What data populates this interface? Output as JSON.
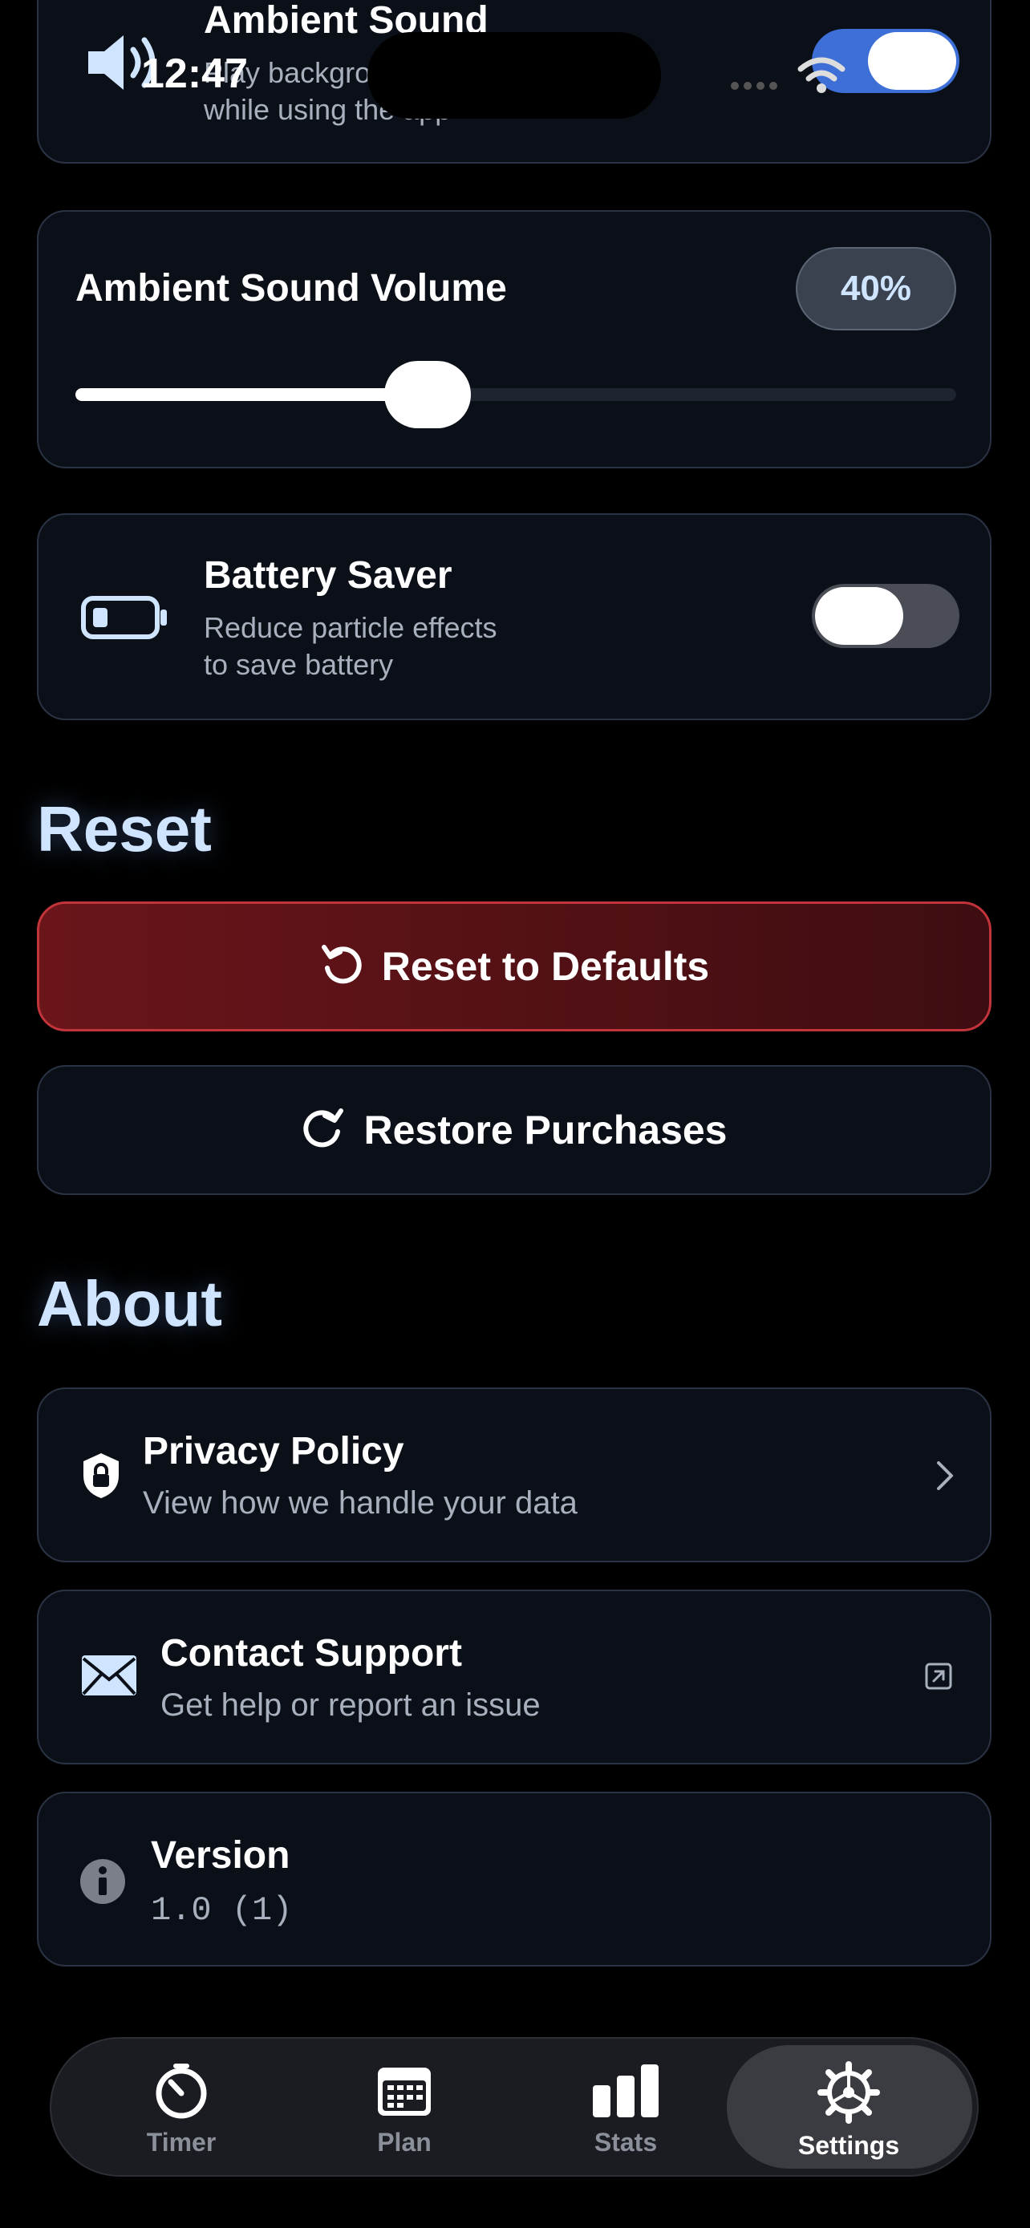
{
  "status_bar": {
    "time": "12:47"
  },
  "ambient_sound": {
    "title": "Ambient Sound",
    "subtitle_line1": "Play background sounds",
    "subtitle_line2": "while using the app",
    "enabled": true
  },
  "ambient_volume": {
    "title": "Ambient Sound Volume",
    "badge": "40%",
    "level_percent": 40
  },
  "battery_saver": {
    "title": "Battery Saver",
    "subtitle_line1": "Reduce particle effects",
    "subtitle_line2": "to save battery",
    "enabled": false
  },
  "reset_section": {
    "heading": "Reset",
    "reset_button": "Reset to Defaults",
    "restore_button": "Restore Purchases"
  },
  "about_section": {
    "heading": "About",
    "privacy": {
      "title": "Privacy Policy",
      "subtitle": "View how we handle your data"
    },
    "support": {
      "title": "Contact Support",
      "subtitle": "Get help or report an issue"
    },
    "version": {
      "title": "Version",
      "value": "1.0 (1)"
    }
  },
  "tab_bar": {
    "items": [
      {
        "label": "Timer",
        "icon": "timer-icon",
        "active": false
      },
      {
        "label": "Plan",
        "icon": "calendar-icon",
        "active": false
      },
      {
        "label": "Stats",
        "icon": "bar-chart-icon",
        "active": false
      },
      {
        "label": "Settings",
        "icon": "gear-icon",
        "active": true
      }
    ]
  },
  "colors": {
    "accent": "#cfe4ff",
    "danger_bg": "#5a1418",
    "danger_border": "#c0343a",
    "card_bg": "#0b0f17",
    "card_border": "#2a3344"
  }
}
